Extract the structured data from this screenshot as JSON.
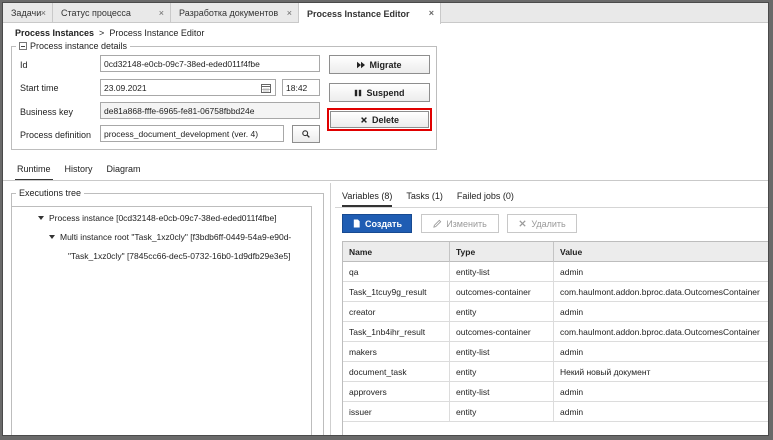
{
  "tabs": [
    {
      "label": "Задачи",
      "active": false
    },
    {
      "label": "Статус процесса",
      "active": false
    },
    {
      "label": "Разработка документов",
      "active": false
    },
    {
      "label": "Process Instance Editor",
      "active": true
    }
  ],
  "tab_close_glyph": "×",
  "breadcrumb": {
    "parent": "Process Instances",
    "separator": ">",
    "current": "Process Instance Editor"
  },
  "details": {
    "legend": "Process instance details",
    "id_label": "Id",
    "id_value": "0cd32148-e0cb-09c7-38ed-eded011f4fbe",
    "start_label": "Start time",
    "start_date": "23.09.2021",
    "start_time": "18:42",
    "business_key_label": "Business key",
    "business_key_value": "de81a868-fffe-6965-fe81-06758fbbd24e",
    "definition_label": "Process definition",
    "definition_value": "process_document_development (ver. 4)"
  },
  "actions": {
    "migrate": "Migrate",
    "suspend": "Suspend",
    "delete": "Delete"
  },
  "subtabs": [
    {
      "label": "Runtime",
      "active": true
    },
    {
      "label": "History",
      "active": false
    },
    {
      "label": "Diagram",
      "active": false
    }
  ],
  "tree": {
    "legend": "Executions tree",
    "rows": [
      {
        "text": "Process instance [0cd32148-e0cb-09c7-38ed-eded011f4fbe]"
      },
      {
        "text": "Multi instance root \"Task_1xz0cly\" [f3bdb6ff-0449-54a9-e90d-"
      },
      {
        "text": "\"Task_1xz0cly\" [7845cc66-dec5-0732-16b0-1d9dfb29e3e5]"
      }
    ]
  },
  "right_tabs": [
    {
      "label": "Variables (8)",
      "active": true
    },
    {
      "label": "Tasks (1)",
      "active": false
    },
    {
      "label": "Failed jobs (0)",
      "active": false
    }
  ],
  "toolbar": {
    "create": "Создать",
    "edit": "Изменить",
    "remove": "Удалить"
  },
  "variables": {
    "columns": [
      "Name",
      "Type",
      "Value"
    ],
    "rows": [
      [
        "qa",
        "entity-list",
        "admin"
      ],
      [
        "Task_1tcuy9g_result",
        "outcomes-container",
        "com.haulmont.addon.bproc.data.OutcomesContainer"
      ],
      [
        "creator",
        "entity",
        "admin"
      ],
      [
        "Task_1nb4ihr_result",
        "outcomes-container",
        "com.haulmont.addon.bproc.data.OutcomesContainer"
      ],
      [
        "makers",
        "entity-list",
        "admin"
      ],
      [
        "document_task",
        "entity",
        "Некий новый документ"
      ],
      [
        "approvers",
        "entity-list",
        "admin"
      ],
      [
        "issuer",
        "entity",
        "admin"
      ]
    ]
  },
  "colors": {
    "accent": "#1f5db3",
    "highlight": "#e00000"
  },
  "icons": {
    "migrate": "fast-forward-icon",
    "suspend": "pause-icon",
    "delete": "close-icon",
    "create": "document-icon",
    "edit": "pencil-icon",
    "remove": "close-icon",
    "calendar": "calendar-icon",
    "search": "search-icon",
    "collapse": "minus-square-icon",
    "expand": "triangle-down-icon"
  }
}
